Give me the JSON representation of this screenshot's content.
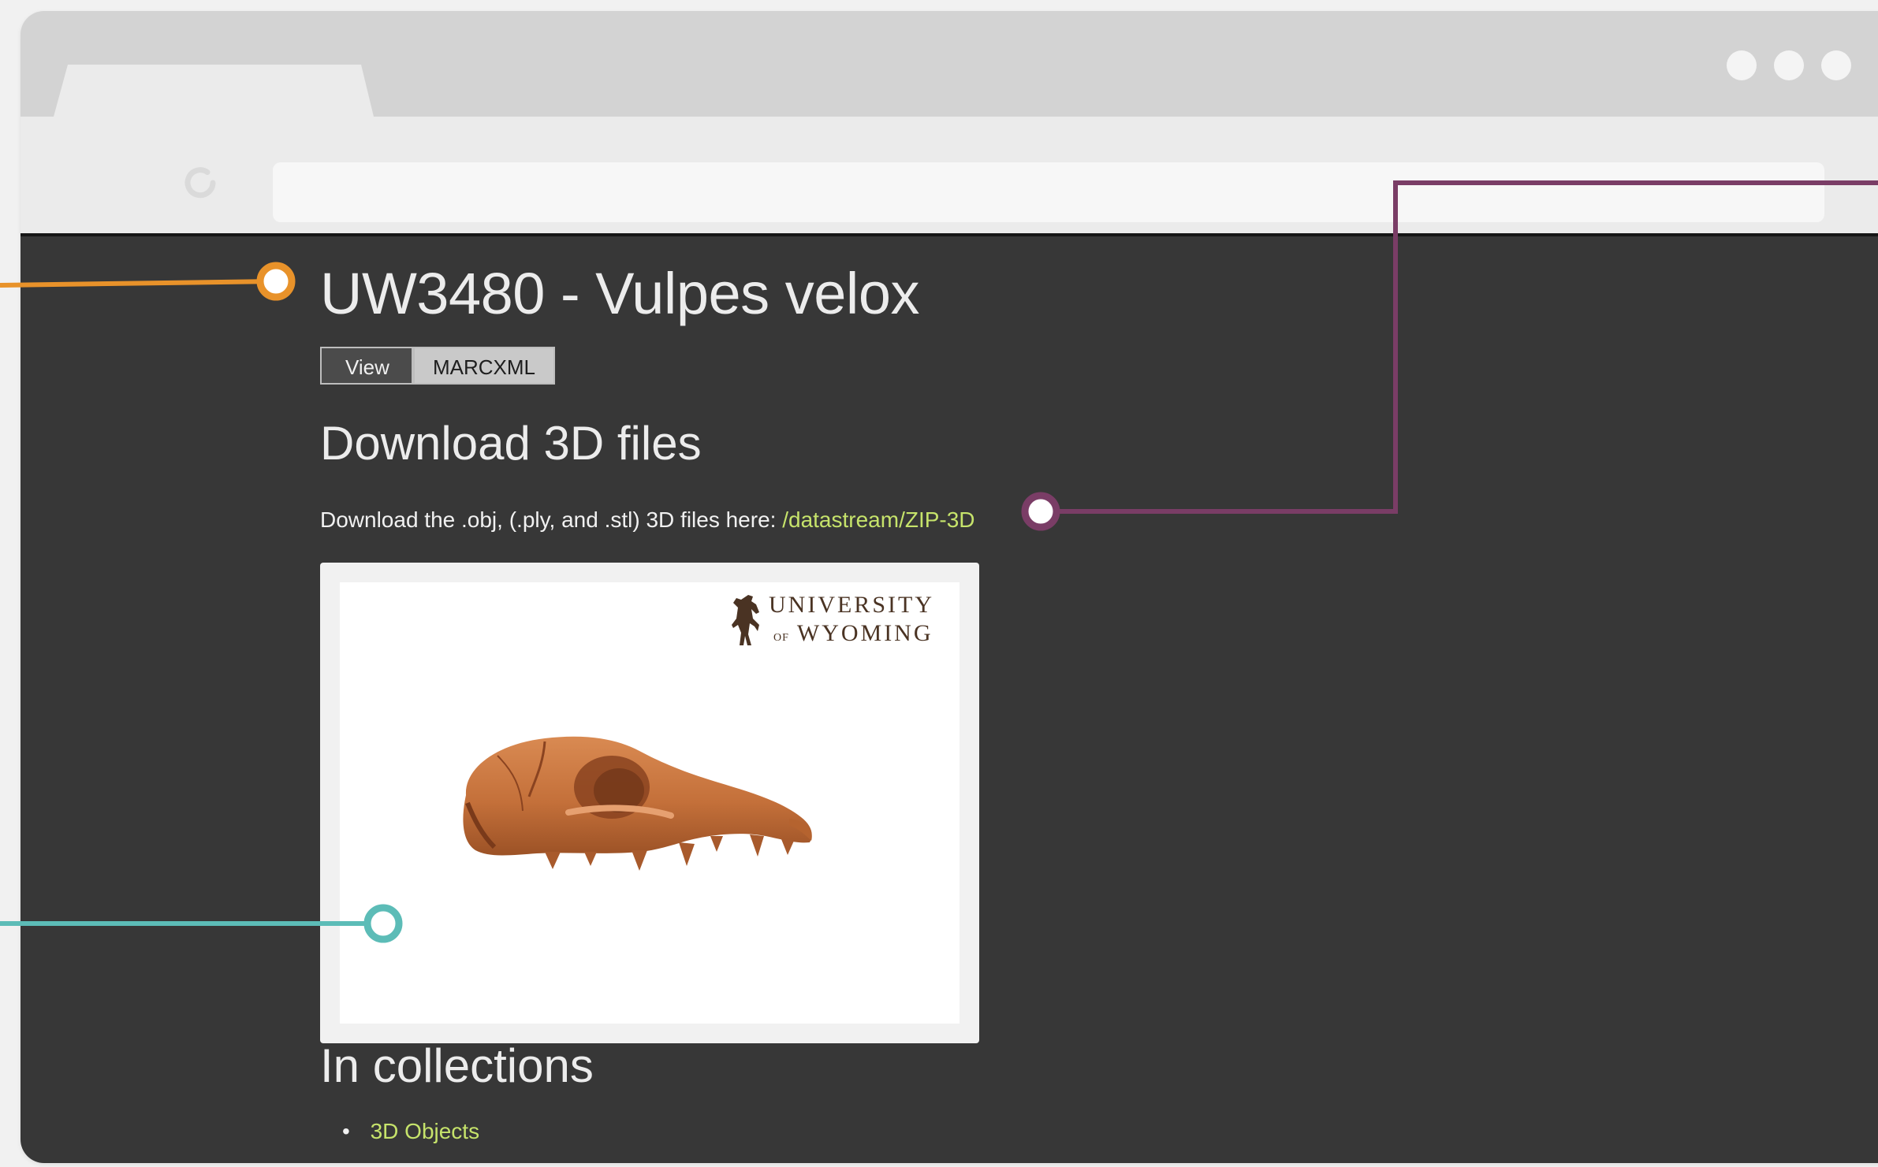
{
  "page": {
    "title": "UW3480 - Vulpes velox"
  },
  "view_tabs": [
    {
      "label": "View"
    },
    {
      "label": "MARCXML"
    }
  ],
  "download_section": {
    "heading": "Download 3D files",
    "description": "Download the .obj, (.ply, and .stl) 3D files here:",
    "link_text": "/datastream/ZIP-3D"
  },
  "preview": {
    "logo_line1": "UNIVERSITY",
    "logo_of": "OF",
    "logo_line2": "WYOMING"
  },
  "collections_section": {
    "heading": "In collections",
    "items": [
      {
        "label": "3D Objects"
      }
    ]
  },
  "colors": {
    "page_background": "#373737",
    "link": "#c6e36b",
    "callout_orange": "#e8922a",
    "callout_purple": "#7a3d66",
    "callout_teal": "#5cbcb7"
  }
}
